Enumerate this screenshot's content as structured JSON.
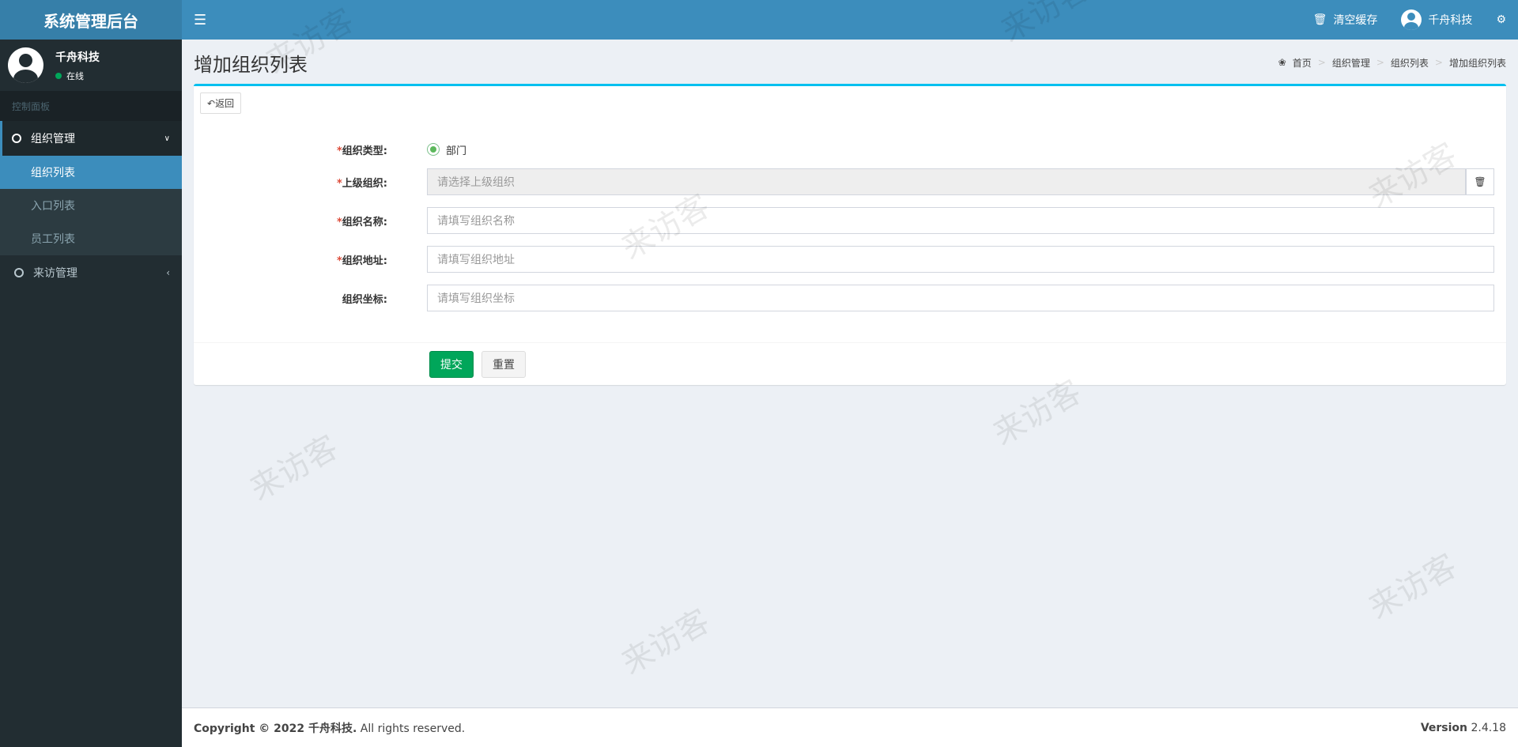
{
  "app": {
    "title": "系统管理后台"
  },
  "header": {
    "clear_cache": "清空缓存",
    "user_name": "千舟科技"
  },
  "sidebar": {
    "user_name": "千舟科技",
    "user_status": "在线",
    "section_header": "控制面板",
    "menu": [
      {
        "label": "组织管理",
        "children": [
          "组织列表",
          "入口列表",
          "员工列表"
        ]
      },
      {
        "label": "来访管理"
      }
    ]
  },
  "page": {
    "title": "增加组织列表",
    "breadcrumb": [
      "首页",
      "组织管理",
      "组织列表",
      "增加组织列表"
    ],
    "back_label": "返回"
  },
  "form": {
    "type_label": "组织类型:",
    "type_option": "部门",
    "parent_label": "上级组织:",
    "parent_placeholder": "请选择上级组织",
    "name_label": "组织名称:",
    "name_placeholder": "请填写组织名称",
    "address_label": "组织地址:",
    "address_placeholder": "请填写组织地址",
    "coords_label": "组织坐标:",
    "coords_placeholder": "请填写组织坐标",
    "submit_label": "提交",
    "reset_label": "重置"
  },
  "footer": {
    "copyright_prefix": "Copyright © 2022",
    "company": "千舟科技.",
    "rights": "All rights reserved.",
    "version_label": "Version",
    "version": "2.4.18"
  },
  "watermark": "来访客",
  "colors": {
    "header": "#3c8dbc",
    "sidebar": "#222d32",
    "accent": "#00c0ef",
    "success": "#00a65a"
  }
}
